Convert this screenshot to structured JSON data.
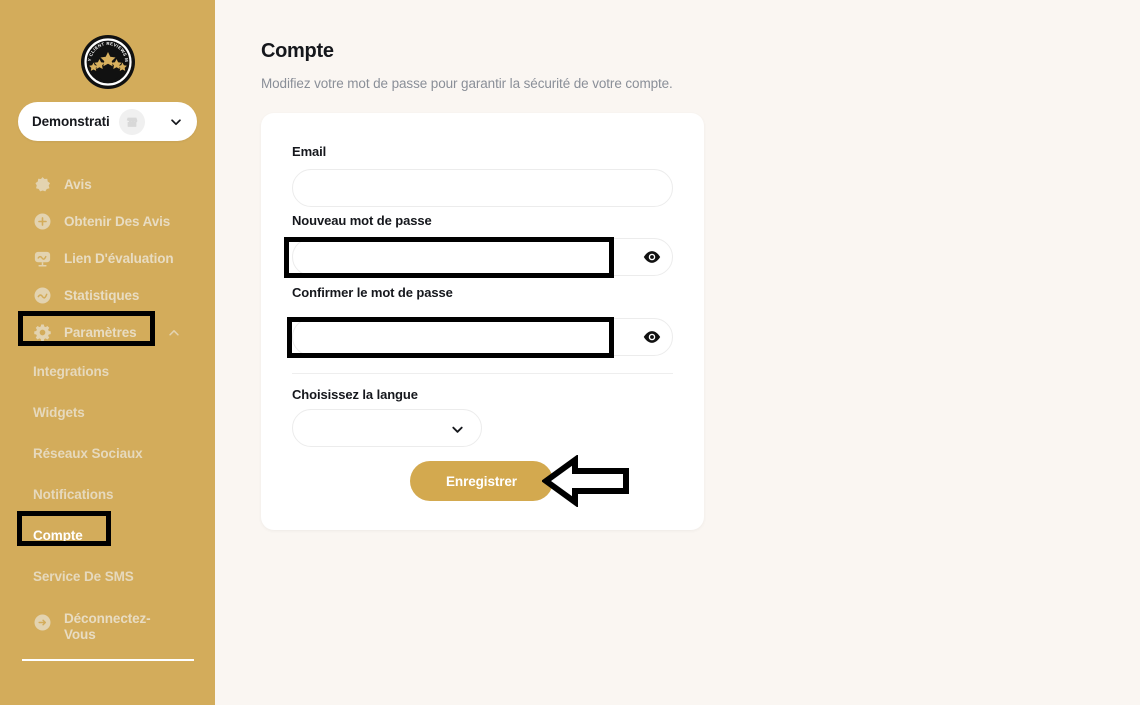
{
  "brand": {
    "logo_alt": "My Client Reviews Me",
    "logo_arc_text": "MY CLIENT REVIEWS ME",
    "logo_star_count": 5,
    "sidebar_color": "#d3ac5b",
    "accent_color": "#d3a94f",
    "page_background": "#faf6f2"
  },
  "sidebar": {
    "account_switcher": {
      "name": "Demonstrati",
      "icon": "store-icon",
      "chevron": "chevron-down-icon"
    },
    "nav_items": [
      {
        "label": "Avis",
        "icon": "star-icon",
        "active": false
      },
      {
        "label": "Obtenir Des Avis",
        "icon": "plus-circle-icon",
        "active": false
      },
      {
        "label": "Lien D'évaluation",
        "icon": "speech-bubble-icon",
        "active": false
      },
      {
        "label": "Statistiques",
        "icon": "chart-circle-icon",
        "active": false
      },
      {
        "label": "Paramètres",
        "icon": "gear-icon",
        "active": false,
        "expanded": true,
        "chevron": "chevron-up-icon"
      }
    ],
    "sub_items": [
      {
        "label": "Integrations",
        "active": false
      },
      {
        "label": "Widgets",
        "active": false
      },
      {
        "label": "Réseaux Sociaux",
        "active": false
      },
      {
        "label": "Notifications",
        "active": false
      },
      {
        "label": "Compte",
        "active": true
      },
      {
        "label": "Service De SMS",
        "active": false
      }
    ],
    "logout": {
      "label": "Déconnectez-Vous",
      "icon": "logout-arrow-icon"
    }
  },
  "main": {
    "title": "Compte",
    "subtitle": "Modifiez votre mot de passe pour garantir la sécurité de votre compte.",
    "form": {
      "email": {
        "label": "Email",
        "value": "",
        "placeholder": ""
      },
      "new_password": {
        "label": "Nouveau mot de passe",
        "value": "",
        "placeholder": "",
        "toggle_icon": "eye-icon"
      },
      "confirm_password": {
        "label": "Confirmer le mot de passe",
        "value": "",
        "placeholder": "",
        "toggle_icon": "eye-icon"
      },
      "language": {
        "label": "Choisissez la langue",
        "value": "",
        "chevron": "chevron-down-icon"
      },
      "submit": {
        "label": "Enregistrer"
      }
    }
  },
  "annotations": {
    "boxes": [
      {
        "target": "sidebar-item-parametres"
      },
      {
        "target": "sidebar-subitem-compte"
      },
      {
        "target": "new-password-input"
      },
      {
        "target": "confirm-password-input"
      }
    ],
    "arrow": {
      "direction": "left",
      "points_to": "save-button"
    }
  }
}
